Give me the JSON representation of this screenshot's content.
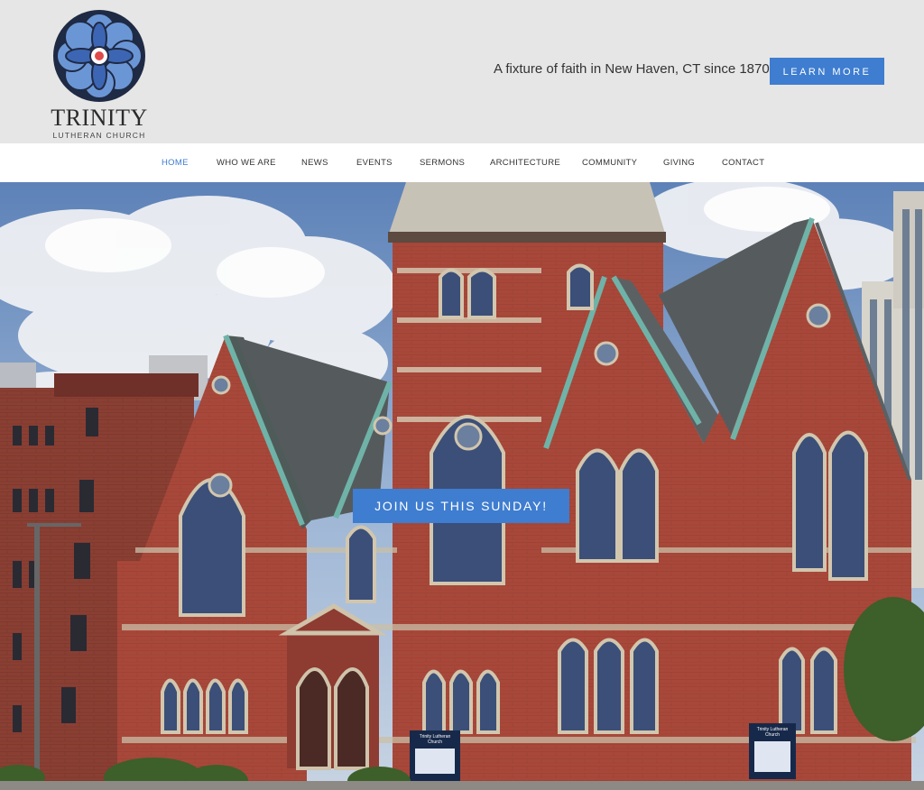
{
  "brand": {
    "name": "Trinity",
    "sub": "Lutheran Church"
  },
  "header": {
    "tagline": "A fixture of faith in New Haven, CT since 1870",
    "cta_label": "LEARN MORE"
  },
  "nav": {
    "items": [
      {
        "label": "HOME",
        "active": true
      },
      {
        "label": "WHO WE ARE"
      },
      {
        "label": "NEWS"
      },
      {
        "label": "EVENTS"
      },
      {
        "label": "SERMONS"
      },
      {
        "label": "ARCHITECTURE"
      },
      {
        "label": "COMMUNITY"
      },
      {
        "label": "GIVING"
      },
      {
        "label": "CONTACT"
      }
    ]
  },
  "hero": {
    "cta_label": "JOIN US THIS SUNDAY!",
    "sign_text": "Trinity Lutheran Church"
  },
  "colors": {
    "accent": "#3e7dd0",
    "header_bg": "#e6e6e6",
    "brick": "#a8483a"
  }
}
